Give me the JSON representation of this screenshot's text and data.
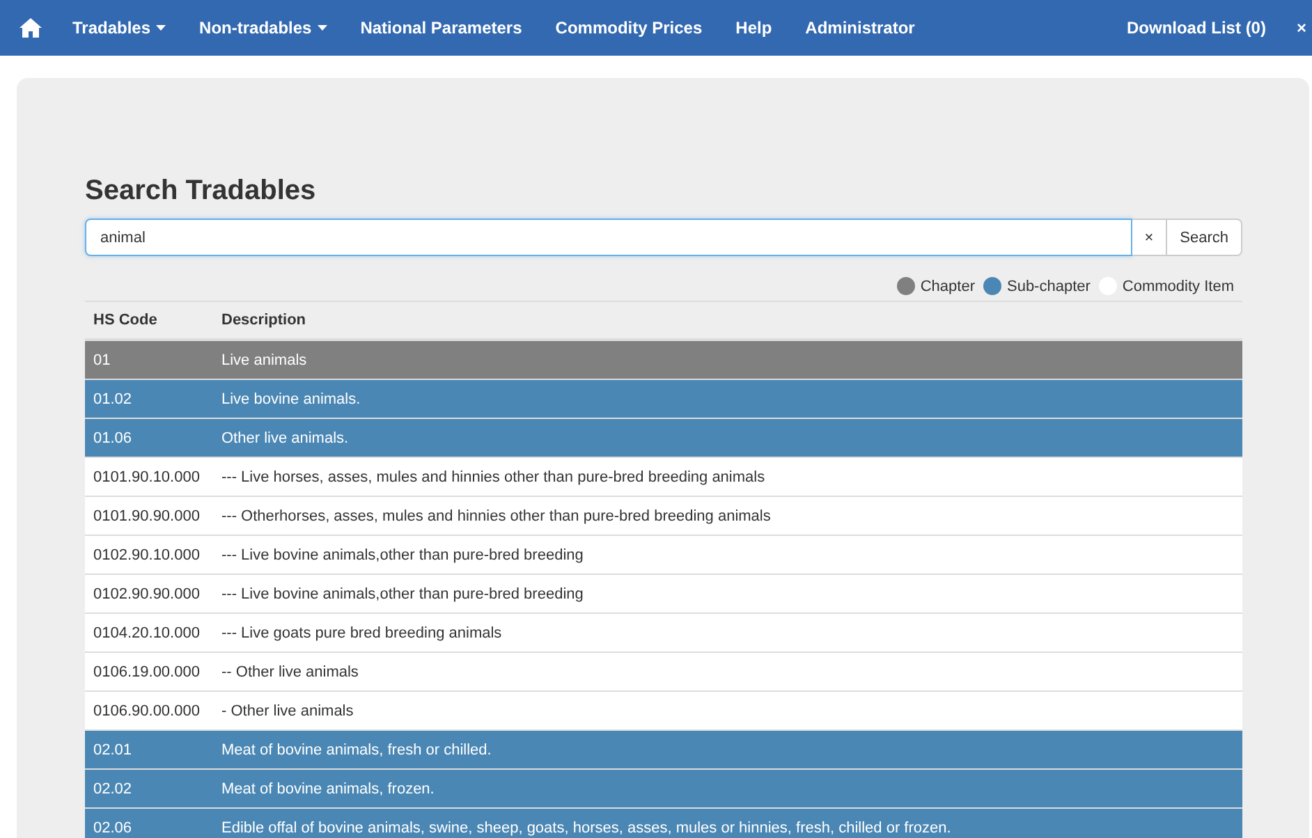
{
  "navbar": {
    "items": [
      {
        "label": "Tradables",
        "dropdown": true
      },
      {
        "label": "Non-tradables",
        "dropdown": true
      },
      {
        "label": "National Parameters",
        "dropdown": false
      },
      {
        "label": "Commodity Prices",
        "dropdown": false
      },
      {
        "label": "Help",
        "dropdown": false
      },
      {
        "label": "Administrator",
        "dropdown": false
      }
    ],
    "download": "Download List (0)",
    "close": "×"
  },
  "title": "Search Tradables",
  "search": {
    "value": "animal",
    "clear": "×",
    "button": "Search"
  },
  "legend": [
    {
      "label": "Chapter",
      "color": "#808080"
    },
    {
      "label": "Sub-chapter",
      "color": "#4a87b4"
    },
    {
      "label": "Commodity Item",
      "color": "#ffffff"
    }
  ],
  "table": {
    "columns": [
      "HS Code",
      "Description"
    ],
    "rows": [
      {
        "kind": "chapter",
        "code": "01",
        "description": "Live animals"
      },
      {
        "kind": "subchapter",
        "code": "01.02",
        "description": "Live bovine animals."
      },
      {
        "kind": "subchapter",
        "code": "01.06",
        "description": "Other live animals."
      },
      {
        "kind": "item",
        "code": "0101.90.10.000",
        "description": "--- Live horses, asses, mules and hinnies other than pure-bred breeding animals"
      },
      {
        "kind": "item",
        "code": "0101.90.90.000",
        "description": "--- Otherhorses, asses, mules and hinnies other than pure-bred breeding animals"
      },
      {
        "kind": "item",
        "code": "0102.90.10.000",
        "description": "--- Live bovine animals,other than pure-bred breeding"
      },
      {
        "kind": "item",
        "code": "0102.90.90.000",
        "description": "--- Live bovine animals,other than pure-bred breeding"
      },
      {
        "kind": "item",
        "code": "0104.20.10.000",
        "description": "--- Live goats pure bred breeding animals"
      },
      {
        "kind": "item",
        "code": "0106.19.00.000",
        "description": "-- Other live animals"
      },
      {
        "kind": "item",
        "code": "0106.90.00.000",
        "description": "- Other live animals"
      },
      {
        "kind": "subchapter",
        "code": "02.01",
        "description": "Meat of bovine animals, fresh or chilled."
      },
      {
        "kind": "subchapter",
        "code": "02.02",
        "description": "Meat of bovine animals, frozen."
      },
      {
        "kind": "subchapter",
        "code": "02.06",
        "description": "Edible offal of bovine animals, swine, sheep, goats, horses, asses, mules or hinnies, fresh, chilled or frozen."
      }
    ]
  }
}
